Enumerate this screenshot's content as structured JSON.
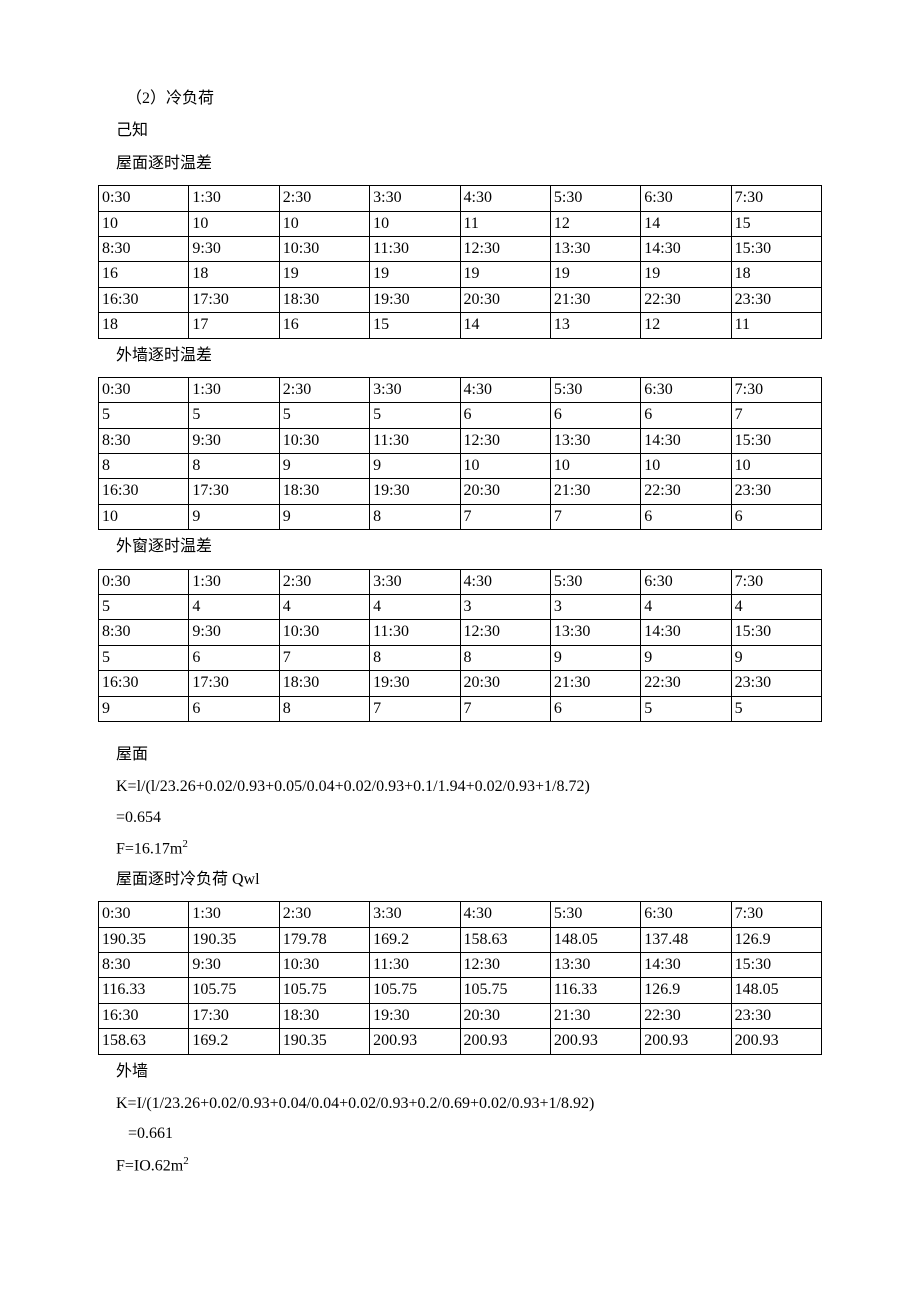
{
  "heading_section": "（2）冷负荷",
  "known_label": "己知",
  "roof_diff_title": "屋面逐时温差",
  "wall_diff_title": "外墙逐时温差",
  "window_diff_title": "外窗逐时温差",
  "roof_diff": {
    "r1": [
      "0:30",
      "1:30",
      "2:30",
      "3:30",
      "4:30",
      "5:30",
      "6:30",
      "7:30"
    ],
    "r2": [
      "10",
      "10",
      "10",
      "10",
      "11",
      "12",
      "14",
      "15"
    ],
    "r3": [
      "8:30",
      "9:30",
      "10:30",
      "11:30",
      "12:30",
      "13:30",
      "14:30",
      "15:30"
    ],
    "r4": [
      "16",
      "18",
      "19",
      "19",
      "19",
      "19",
      "19",
      "18"
    ],
    "r5": [
      "16:30",
      "17:30",
      "18:30",
      "19:30",
      "20:30",
      "21:30",
      "22:30",
      "23:30"
    ],
    "r6": [
      "18",
      "17",
      "16",
      "15",
      "14",
      "13",
      "12",
      "11"
    ]
  },
  "wall_diff": {
    "r1": [
      "0:30",
      "1:30",
      "2:30",
      "3:30",
      "4:30",
      "5:30",
      "6:30",
      "7:30"
    ],
    "r2": [
      "5",
      "5",
      "5",
      "5",
      "6",
      "6",
      "6",
      "7"
    ],
    "r3": [
      "8:30",
      "9:30",
      "10:30",
      "11:30",
      "12:30",
      "13:30",
      "14:30",
      "15:30"
    ],
    "r4": [
      "8",
      "8",
      "9",
      "9",
      "10",
      "10",
      "10",
      "10"
    ],
    "r5": [
      "16:30",
      "17:30",
      "18:30",
      "19:30",
      "20:30",
      "21:30",
      "22:30",
      "23:30"
    ],
    "r6": [
      "10",
      "9",
      "9",
      "8",
      "7",
      "7",
      "6",
      "6"
    ]
  },
  "window_diff": {
    "r1": [
      "0:30",
      "1:30",
      "2:30",
      "3:30",
      "4:30",
      "5:30",
      "6:30",
      "7:30"
    ],
    "r2": [
      "5",
      "4",
      "4",
      "4",
      "3",
      "3",
      "4",
      "4"
    ],
    "r3": [
      "8:30",
      "9:30",
      "10:30",
      "11:30",
      "12:30",
      "13:30",
      "14:30",
      "15:30"
    ],
    "r4": [
      "5",
      "6",
      "7",
      "8",
      "8",
      "9",
      "9",
      "9"
    ],
    "r5": [
      "16:30",
      "17:30",
      "18:30",
      "19:30",
      "20:30",
      "21:30",
      "22:30",
      "23:30"
    ],
    "r6": [
      "9",
      "6",
      "8",
      "7",
      "7",
      "6",
      "5",
      "5"
    ]
  },
  "roof_label": "屋面",
  "roof_K": "K=l/(l/23.26+0.02/0.93+0.05/0.04+0.02/0.93+0.1/1.94+0.02/0.93+1/8.72)",
  "roof_K_res": "=0.654",
  "roof_F_pre": "F=16.17m",
  "roof_F_sup": "2",
  "roof_Qwl_title": "屋面逐时冷负荷 Qwl",
  "roof_Qwl": {
    "r1": [
      "0:30",
      "1:30",
      "2:30",
      "3:30",
      "4:30",
      "5:30",
      "6:30",
      "7:30"
    ],
    "r2": [
      "190.35",
      "190.35",
      "179.78",
      "169.2",
      "158.63",
      "148.05",
      "137.48",
      "126.9"
    ],
    "r3": [
      "8:30",
      "9:30",
      "10:30",
      "11:30",
      "12:30",
      "13:30",
      "14:30",
      "15:30"
    ],
    "r4": [
      "116.33",
      "105.75",
      "105.75",
      "105.75",
      "105.75",
      "116.33",
      "126.9",
      "148.05"
    ],
    "r5": [
      "16:30",
      "17:30",
      "18:30",
      "19:30",
      "20:30",
      "21:30",
      "22:30",
      "23:30"
    ],
    "r6": [
      "158.63",
      "169.2",
      "190.35",
      "200.93",
      "200.93",
      "200.93",
      "200.93",
      "200.93"
    ]
  },
  "wall_label": "外墙",
  "wall_K": "K=I/(1/23.26+0.02/0.93+0.04/0.04+0.02/0.93+0.2/0.69+0.02/0.93+1/8.92)",
  "wall_K_res": "=0.661",
  "wall_F_pre": "F=IO.62m",
  "wall_F_sup": "2"
}
